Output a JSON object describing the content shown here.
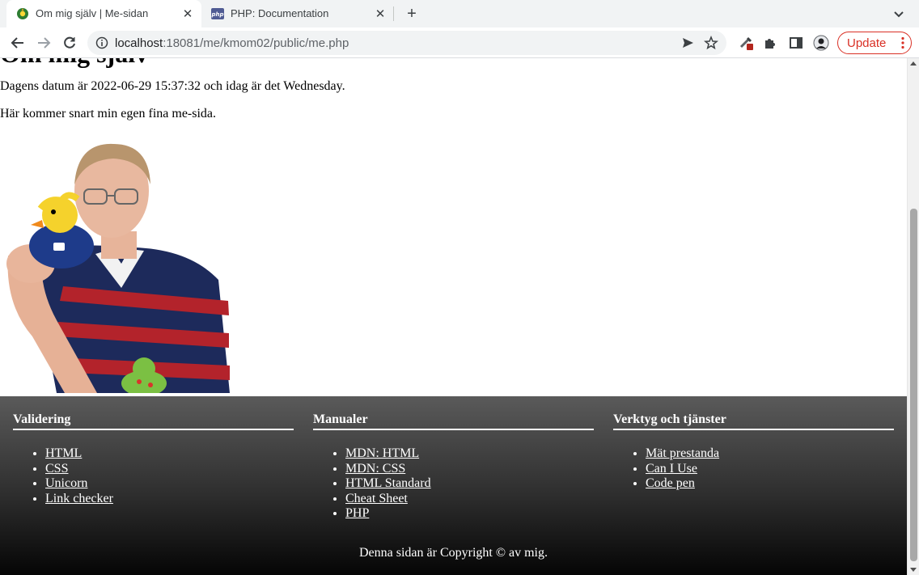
{
  "browser": {
    "tabs": [
      {
        "title": "Om mig själv | Me-sidan",
        "active": true,
        "favicon": "site-favicon"
      },
      {
        "title": "PHP: Documentation",
        "active": false,
        "favicon": "php-favicon",
        "favicon_text": "php"
      }
    ],
    "address": {
      "host": "localhost",
      "rest": ":18081/me/kmom02/public/me.php"
    },
    "update_label": "Update",
    "icons": {
      "back": "back-arrow-icon",
      "forward": "forward-arrow-icon",
      "reload": "reload-icon",
      "info": "info-icon",
      "send": "send-icon",
      "star": "bookmark-star-icon",
      "extension_a": "extension-eyedropper-icon",
      "extensions": "puzzle-icon",
      "side_panel": "side-panel-icon",
      "profile": "profile-avatar-icon",
      "menu": "kebab-menu-icon"
    },
    "accent_color": "#d93025"
  },
  "page": {
    "heading": "Om mig själv",
    "date_line": "Dagens datum är 2022-06-29 15:37:32 och idag är det Wednesday.",
    "intro": "Här kommer snart min egen fina me-sida."
  },
  "footer": {
    "columns": [
      {
        "title": "Validering",
        "links": [
          "HTML",
          "CSS",
          "Unicorn",
          "Link checker"
        ]
      },
      {
        "title": "Manualer",
        "links": [
          "MDN: HTML",
          "MDN: CSS",
          "HTML Standard",
          "Cheat Sheet",
          "PHP"
        ]
      },
      {
        "title": "Verktyg och tjänster",
        "links": [
          "Mät prestanda",
          "Can I Use",
          "Code pen"
        ]
      }
    ],
    "copyright": "Denna sidan är Copyright © av mig."
  }
}
